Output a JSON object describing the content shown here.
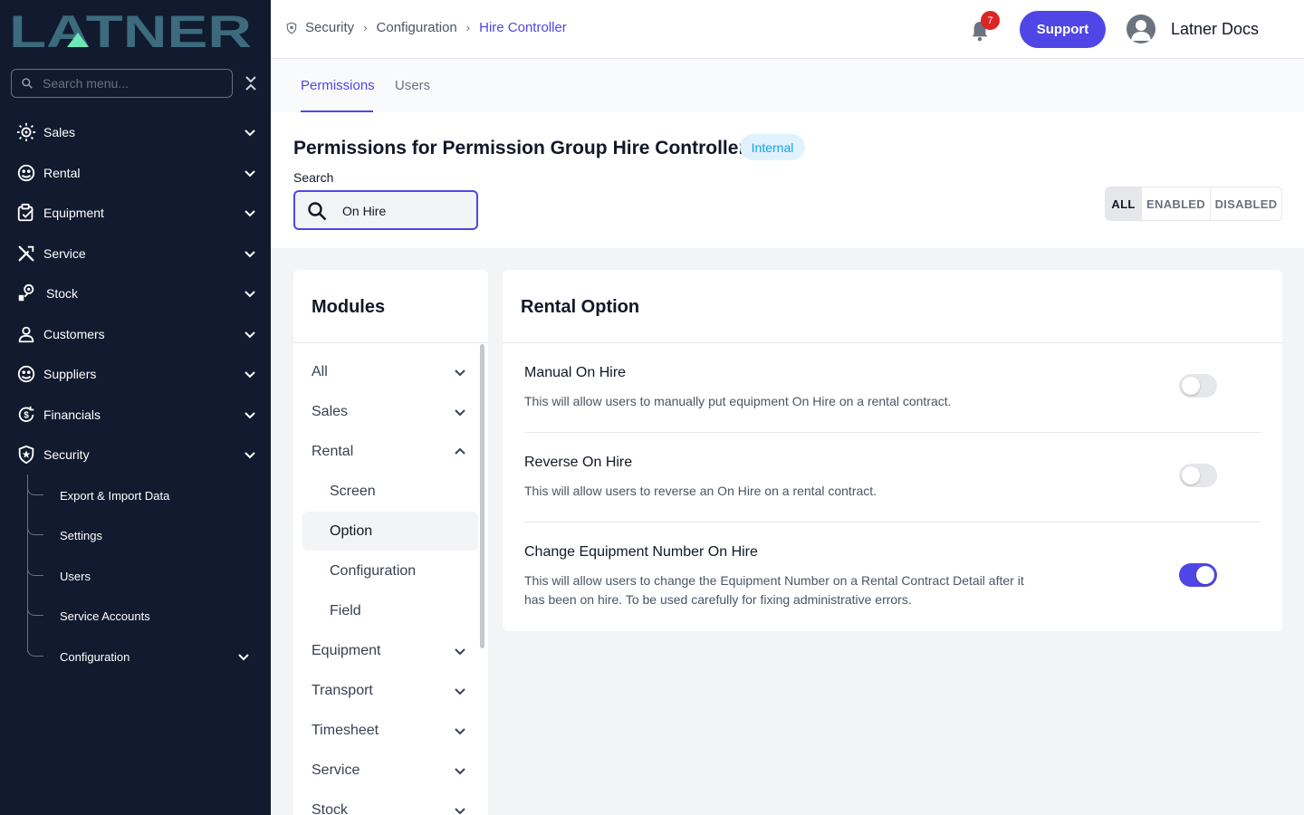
{
  "app": {
    "logo_text": "LATNER"
  },
  "sidebar": {
    "search_placeholder": "Search menu...",
    "items": [
      {
        "label": "Sales",
        "icon": "sales-icon"
      },
      {
        "label": "Rental",
        "icon": "rental-icon"
      },
      {
        "label": "Equipment",
        "icon": "equipment-icon"
      },
      {
        "label": "Service",
        "icon": "service-icon"
      },
      {
        "label": "Stock",
        "icon": "stock-icon"
      },
      {
        "label": "Customers",
        "icon": "customers-icon"
      },
      {
        "label": "Suppliers",
        "icon": "suppliers-icon"
      },
      {
        "label": "Financials",
        "icon": "financials-icon"
      },
      {
        "label": "Security",
        "icon": "security-icon"
      }
    ],
    "security_children": [
      {
        "label": "Export & Import Data"
      },
      {
        "label": "Settings"
      },
      {
        "label": "Users"
      },
      {
        "label": "Service Accounts"
      },
      {
        "label": "Configuration"
      }
    ]
  },
  "header": {
    "breadcrumb": [
      "Security",
      "Configuration",
      "Hire Controller"
    ],
    "notification_count": "7",
    "support_label": "Support",
    "user_name": "Latner Docs"
  },
  "tabs": [
    {
      "label": "Permissions",
      "active": true
    },
    {
      "label": "Users",
      "active": false
    }
  ],
  "page": {
    "title_prefix": "Permissions for Permission Group",
    "group_name": "Hire Controller",
    "badge": "Internal",
    "search_label": "Search",
    "search_value": "On Hire",
    "filters": [
      "ALL",
      "ENABLED",
      "DISABLED"
    ],
    "selected_filter": "ALL"
  },
  "modules": {
    "title": "Modules",
    "items": [
      {
        "label": "All",
        "expanded": false
      },
      {
        "label": "Sales",
        "expanded": false
      },
      {
        "label": "Rental",
        "expanded": true
      },
      {
        "label": "Screen",
        "child": true
      },
      {
        "label": "Option",
        "child": true,
        "selected": true
      },
      {
        "label": "Configuration",
        "child": true
      },
      {
        "label": "Field",
        "child": true
      },
      {
        "label": "Equipment",
        "expanded": false
      },
      {
        "label": "Transport",
        "expanded": false
      },
      {
        "label": "Timesheet",
        "expanded": false
      },
      {
        "label": "Service",
        "expanded": false
      },
      {
        "label": "Stock",
        "expanded": false
      }
    ]
  },
  "options": {
    "title": "Rental Option",
    "permissions": [
      {
        "name": "Manual On Hire",
        "description": "This will allow users to manually put equipment On Hire on a rental contract.",
        "enabled": false
      },
      {
        "name": "Reverse On Hire",
        "description": "This will allow users to reverse an On Hire on a rental contract.",
        "enabled": false
      },
      {
        "name": "Change Equipment Number On Hire",
        "description": "This will allow users to change the Equipment Number on a Rental Contract Detail after it has been on hire. To be used carefully for fixing administrative errors.",
        "enabled": true
      }
    ]
  },
  "colors": {
    "sidebar_bg": "#111a2e",
    "accent": "#4f46e5",
    "badge_red": "#dc2626",
    "logo_teal": "#3b6b7d",
    "logo_green": "#6ee7b7"
  }
}
